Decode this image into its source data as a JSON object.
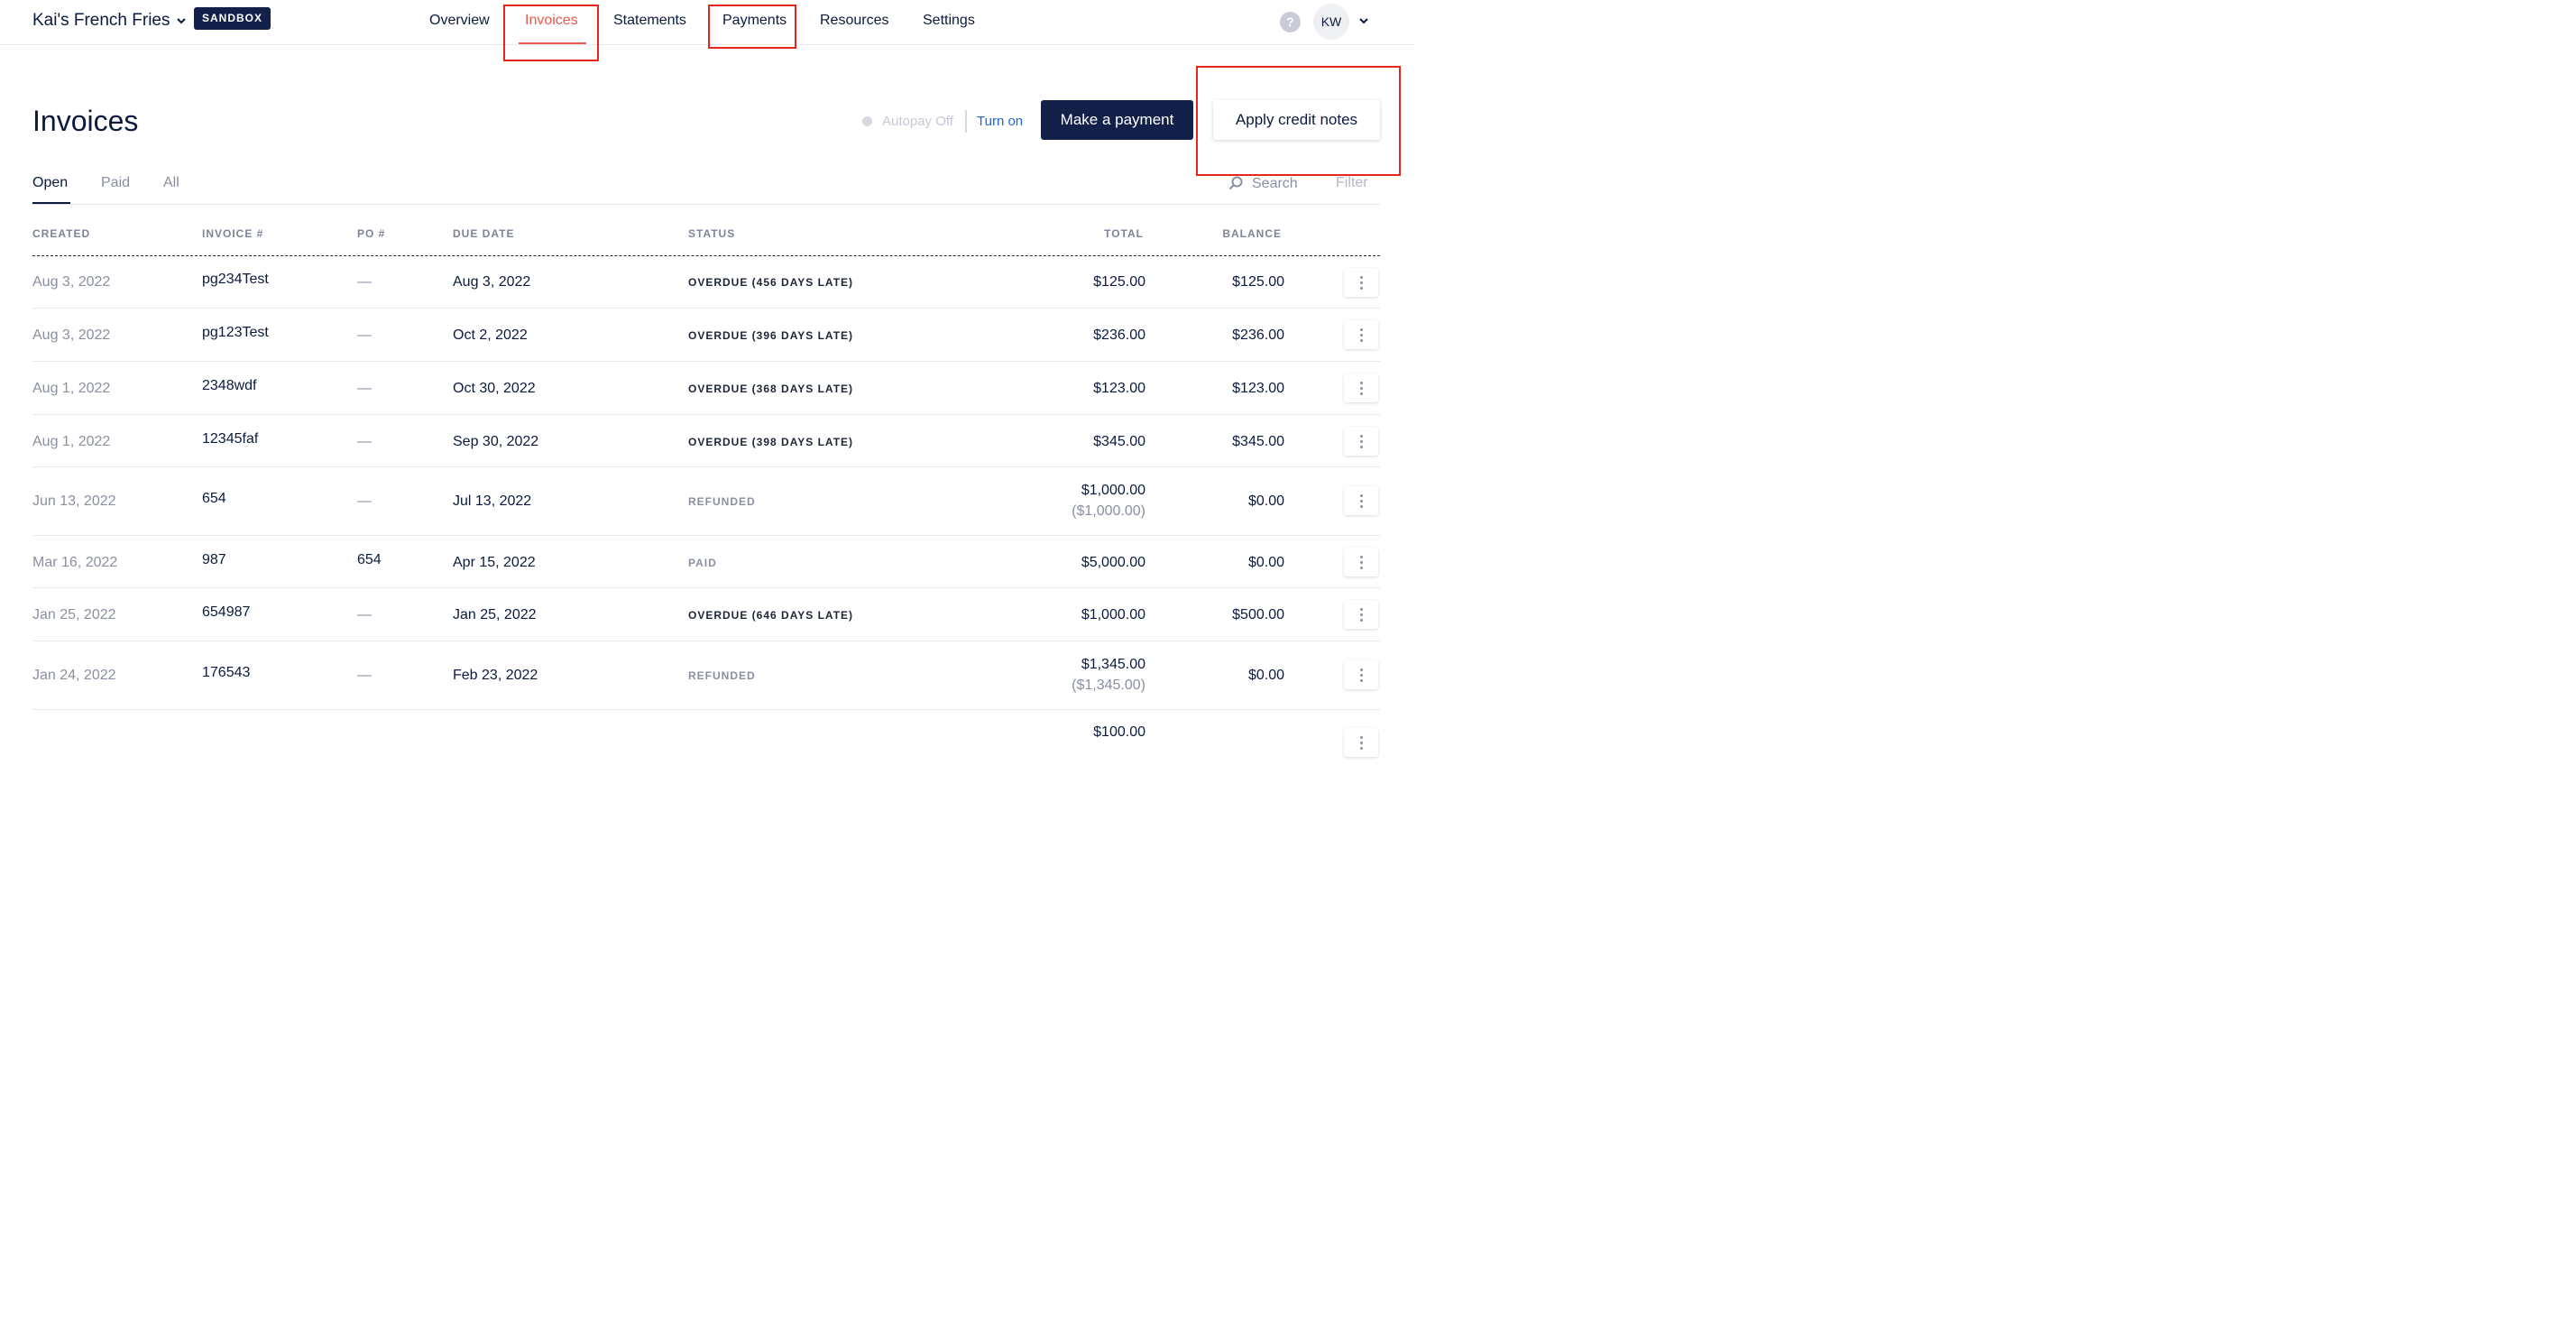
{
  "company": {
    "name": "Kai's French Fries",
    "badge": "SANDBOX"
  },
  "nav": [
    {
      "label": "Overview",
      "active": false
    },
    {
      "label": "Invoices",
      "active": true
    },
    {
      "label": "Statements",
      "active": false
    },
    {
      "label": "Payments",
      "active": false
    },
    {
      "label": "Resources",
      "active": false
    },
    {
      "label": "Settings",
      "active": false
    }
  ],
  "user": {
    "help": "?",
    "initials": "KW"
  },
  "page": {
    "title": "Invoices"
  },
  "autopay": {
    "status": "Autopay Off",
    "action": "Turn on"
  },
  "actions": {
    "make_payment": "Make a payment",
    "apply_credit": "Apply credit notes"
  },
  "tabs": [
    {
      "label": "Open",
      "active": true
    },
    {
      "label": "Paid",
      "active": false
    },
    {
      "label": "All",
      "active": false
    }
  ],
  "search": {
    "label": "Search"
  },
  "filter": {
    "label": "Filter"
  },
  "table": {
    "columns": {
      "created": "CREATED",
      "invoice": "INVOICE #",
      "po": "PO #",
      "due": "DUE DATE",
      "status": "STATUS",
      "total": "TOTAL",
      "balance": "BALANCE"
    },
    "rows": [
      {
        "created": "Aug 3, 2022",
        "invoice": "pg234Test",
        "po": "—",
        "due": "Aug 3, 2022",
        "status": "OVERDUE (456 DAYS LATE)",
        "status_type": "overdue",
        "total": "$125.00",
        "total_sub": "",
        "balance": "$125.00"
      },
      {
        "created": "Aug 3, 2022",
        "invoice": "pg123Test",
        "po": "—",
        "due": "Oct 2, 2022",
        "status": "OVERDUE (396 DAYS LATE)",
        "status_type": "overdue",
        "total": "$236.00",
        "total_sub": "",
        "balance": "$236.00"
      },
      {
        "created": "Aug 1, 2022",
        "invoice": "2348wdf",
        "po": "—",
        "due": "Oct 30, 2022",
        "status": "OVERDUE (368 DAYS LATE)",
        "status_type": "overdue",
        "total": "$123.00",
        "total_sub": "",
        "balance": "$123.00"
      },
      {
        "created": "Aug 1, 2022",
        "invoice": "12345faf",
        "po": "—",
        "due": "Sep 30, 2022",
        "status": "OVERDUE (398 DAYS LATE)",
        "status_type": "overdue",
        "total": "$345.00",
        "total_sub": "",
        "balance": "$345.00"
      },
      {
        "created": "Jun 13, 2022",
        "invoice": "654",
        "po": "—",
        "due": "Jul 13, 2022",
        "status": "REFUNDED",
        "status_type": "muted",
        "total": "$1,000.00",
        "total_sub": "($1,000.00)",
        "balance": "$0.00"
      },
      {
        "created": "Mar 16, 2022",
        "invoice": "987",
        "po": "654",
        "due": "Apr 15, 2022",
        "status": "PAID",
        "status_type": "muted",
        "total": "$5,000.00",
        "total_sub": "",
        "balance": "$0.00"
      },
      {
        "created": "Jan 25, 2022",
        "invoice": "654987",
        "po": "—",
        "due": "Jan 25, 2022",
        "status": "OVERDUE (646 DAYS LATE)",
        "status_type": "overdue",
        "total": "$1,000.00",
        "total_sub": "",
        "balance": "$500.00"
      },
      {
        "created": "Jan 24, 2022",
        "invoice": "176543",
        "po": "—",
        "due": "Feb 23, 2022",
        "status": "REFUNDED",
        "status_type": "muted",
        "total": "$1,345.00",
        "total_sub": "($1,345.00)",
        "balance": "$0.00"
      },
      {
        "created": "",
        "invoice": "",
        "po": "",
        "due": "",
        "status": "",
        "status_type": "muted",
        "total": "$100.00",
        "total_sub": "",
        "balance": ""
      }
    ]
  },
  "colors": {
    "accent": "#e85a4f",
    "primary": "#13214a",
    "link": "#1f63d6",
    "highlight": "#e8261c"
  }
}
